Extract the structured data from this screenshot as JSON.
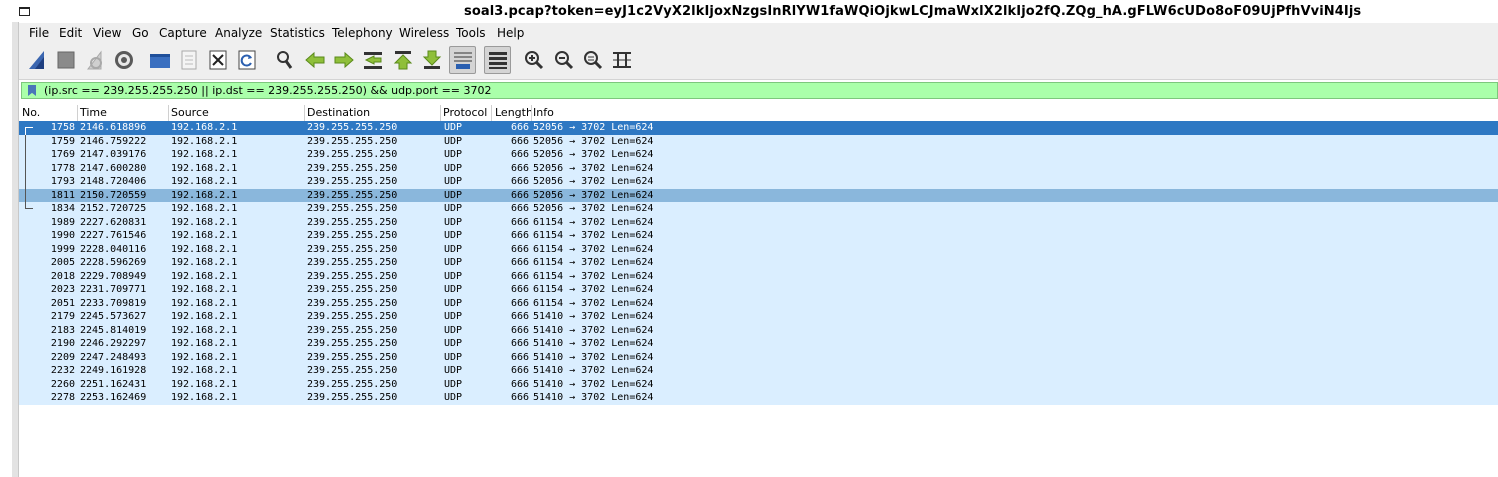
{
  "window": {
    "title": "soal3.pcap?token=eyJ1c2VyX2lkIjoxNzgsInRlYW1faWQiOjkwLCJmaWxlX2lkIjo2fQ.ZQg_hA.gFLW6cUDo8oF09UjPfhVviN4Ijs"
  },
  "menu": [
    "File",
    "Edit",
    "View",
    "Go",
    "Capture",
    "Analyze",
    "Statistics",
    "Telephony",
    "Wireless",
    "Tools",
    "Help"
  ],
  "toolbar": {
    "icons": [
      "shark-fin-start-icon",
      "stop-capture-icon",
      "restart-capture-icon",
      "capture-options-icon",
      "open-file-icon",
      "save-file-icon",
      "close-file-icon",
      "reload-file-icon",
      "find-packet-icon",
      "go-back-icon",
      "go-forward-icon",
      "go-to-packet-icon",
      "go-first-icon",
      "go-last-icon",
      "autoscroll-icon",
      "colorize-icon",
      "zoom-in-icon",
      "zoom-out-icon",
      "zoom-normal-icon",
      "resize-columns-icon"
    ]
  },
  "filter": {
    "value": "(ip.src == 239.255.255.250 || ip.dst == 239.255.255.250) && udp.port == 3702"
  },
  "columns": {
    "no": "No.",
    "time": "Time",
    "source": "Source",
    "destination": "Destination",
    "protocol": "Protocol",
    "length": "Length",
    "info": "Info"
  },
  "packets": [
    {
      "no": "1758",
      "time": "2146.618896",
      "src": "192.168.2.1",
      "dst": "239.255.255.250",
      "proto": "UDP",
      "len": "666",
      "info": "52056 → 3702 Len=624"
    },
    {
      "no": "1759",
      "time": "2146.759222",
      "src": "192.168.2.1",
      "dst": "239.255.255.250",
      "proto": "UDP",
      "len": "666",
      "info": "52056 → 3702 Len=624"
    },
    {
      "no": "1769",
      "time": "2147.039176",
      "src": "192.168.2.1",
      "dst": "239.255.255.250",
      "proto": "UDP",
      "len": "666",
      "info": "52056 → 3702 Len=624"
    },
    {
      "no": "1778",
      "time": "2147.600280",
      "src": "192.168.2.1",
      "dst": "239.255.255.250",
      "proto": "UDP",
      "len": "666",
      "info": "52056 → 3702 Len=624"
    },
    {
      "no": "1793",
      "time": "2148.720406",
      "src": "192.168.2.1",
      "dst": "239.255.255.250",
      "proto": "UDP",
      "len": "666",
      "info": "52056 → 3702 Len=624"
    },
    {
      "no": "1811",
      "time": "2150.720559",
      "src": "192.168.2.1",
      "dst": "239.255.255.250",
      "proto": "UDP",
      "len": "666",
      "info": "52056 → 3702 Len=624"
    },
    {
      "no": "1834",
      "time": "2152.720725",
      "src": "192.168.2.1",
      "dst": "239.255.255.250",
      "proto": "UDP",
      "len": "666",
      "info": "52056 → 3702 Len=624"
    },
    {
      "no": "1989",
      "time": "2227.620831",
      "src": "192.168.2.1",
      "dst": "239.255.255.250",
      "proto": "UDP",
      "len": "666",
      "info": "61154 → 3702 Len=624"
    },
    {
      "no": "1990",
      "time": "2227.761546",
      "src": "192.168.2.1",
      "dst": "239.255.255.250",
      "proto": "UDP",
      "len": "666",
      "info": "61154 → 3702 Len=624"
    },
    {
      "no": "1999",
      "time": "2228.040116",
      "src": "192.168.2.1",
      "dst": "239.255.255.250",
      "proto": "UDP",
      "len": "666",
      "info": "61154 → 3702 Len=624"
    },
    {
      "no": "2005",
      "time": "2228.596269",
      "src": "192.168.2.1",
      "dst": "239.255.255.250",
      "proto": "UDP",
      "len": "666",
      "info": "61154 → 3702 Len=624"
    },
    {
      "no": "2018",
      "time": "2229.708949",
      "src": "192.168.2.1",
      "dst": "239.255.255.250",
      "proto": "UDP",
      "len": "666",
      "info": "61154 → 3702 Len=624"
    },
    {
      "no": "2023",
      "time": "2231.709771",
      "src": "192.168.2.1",
      "dst": "239.255.255.250",
      "proto": "UDP",
      "len": "666",
      "info": "61154 → 3702 Len=624"
    },
    {
      "no": "2051",
      "time": "2233.709819",
      "src": "192.168.2.1",
      "dst": "239.255.255.250",
      "proto": "UDP",
      "len": "666",
      "info": "61154 → 3702 Len=624"
    },
    {
      "no": "2179",
      "time": "2245.573627",
      "src": "192.168.2.1",
      "dst": "239.255.255.250",
      "proto": "UDP",
      "len": "666",
      "info": "51410 → 3702 Len=624"
    },
    {
      "no": "2183",
      "time": "2245.814019",
      "src": "192.168.2.1",
      "dst": "239.255.255.250",
      "proto": "UDP",
      "len": "666",
      "info": "51410 → 3702 Len=624"
    },
    {
      "no": "2190",
      "time": "2246.292297",
      "src": "192.168.2.1",
      "dst": "239.255.255.250",
      "proto": "UDP",
      "len": "666",
      "info": "51410 → 3702 Len=624"
    },
    {
      "no": "2209",
      "time": "2247.248493",
      "src": "192.168.2.1",
      "dst": "239.255.255.250",
      "proto": "UDP",
      "len": "666",
      "info": "51410 → 3702 Len=624"
    },
    {
      "no": "2232",
      "time": "2249.161928",
      "src": "192.168.2.1",
      "dst": "239.255.255.250",
      "proto": "UDP",
      "len": "666",
      "info": "51410 → 3702 Len=624"
    },
    {
      "no": "2260",
      "time": "2251.162431",
      "src": "192.168.2.1",
      "dst": "239.255.255.250",
      "proto": "UDP",
      "len": "666",
      "info": "51410 → 3702 Len=624"
    },
    {
      "no": "2278",
      "time": "2253.162469",
      "src": "192.168.2.1",
      "dst": "239.255.255.250",
      "proto": "UDP",
      "len": "666",
      "info": "51410 → 3702 Len=624"
    }
  ],
  "colors": {
    "row_bg": "#daeeff",
    "selected_row": "#2e78c3",
    "related_row": "#8ab7dc",
    "filter_valid": "#aaffaa"
  }
}
